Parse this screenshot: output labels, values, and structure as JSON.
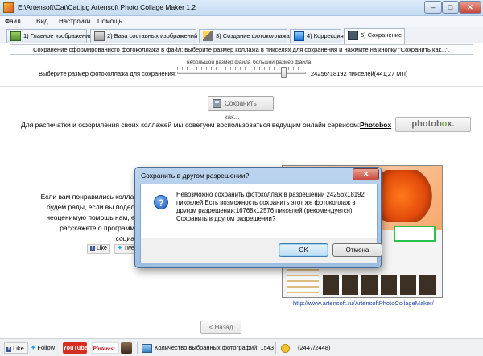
{
  "window": {
    "title": "E:\\Artensoft\\Cat\\Cat.jpg Artensoft Photo Collage Maker 1.2",
    "min": "–",
    "max": "□",
    "close": "✕"
  },
  "menu": [
    "Файл",
    "Вид",
    "Настройки",
    "Помощь"
  ],
  "tabs": [
    {
      "label": "1) Главное изображение",
      "icon": "image-edit-icon"
    },
    {
      "label": "2) База составных изображений",
      "icon": "database-images-icon"
    },
    {
      "label": "3) Создание фотоколлажа",
      "icon": "magic-wand-icon"
    },
    {
      "label": "4) Коррекция",
      "icon": "correction-icon"
    },
    {
      "label": "5) Сохранение",
      "icon": "save-disk-icon",
      "active": true
    }
  ],
  "save_panel": {
    "instruction": "Сохранение сформированного фотоколлажа в файл: выберите размер коллажа в пикселях для сохранения и нажмите на кнопку \"Сохранить как...\".",
    "size_label": "Выберите размер фотоколлажа для сохранения:",
    "small_label": "небольшой размер файла",
    "big_label": "большой размер файла",
    "size_readout": "24256*18192 пикселей(441,27 МП)",
    "slider_position": 0.84,
    "save_button": "Сохранить как..."
  },
  "print_promo": {
    "text": "Для распечатки и оформления своих коллажей мы советуем воспользоваться ведущим онлайн сервисом:",
    "link": "Photobox",
    "logo_part1": "photob",
    "logo_part2": "o",
    "logo_part3": "x."
  },
  "share": {
    "line1": "Если вам понравились коллаж",
    "line2": "будем рады, если вы подели",
    "line3": "неоценимую помощь нам, ес",
    "line4": "расскажете о программе",
    "line5": "социал",
    "fb_like": "Like",
    "tweet": "Twe"
  },
  "url": "http://www.artensoft.ru/ArtensoftPhotoCollageMaker/",
  "back_button": "< Назад",
  "statusbar": {
    "fb_like": "Like",
    "twitter_follow": "Follow",
    "youtube": "YouTube",
    "pinterest": "Pinterest",
    "count_text": "Количество выбранных фотографий: 1543",
    "ratio": "(2447/2448)"
  },
  "dialog": {
    "title": "Сохранить в другом разрешении?",
    "close": "✕",
    "message_l1": "Невозможно сохранить фотоколлаж в разрешении  24256x18192",
    "message_l2": "пикселей Есть возможность сохранить этот же фотоколлаж в",
    "message_l3": "другом разрешении:16768x12576 пикселей (рекомендуется)",
    "message_l4": "Сохранить в другом разрешении?",
    "ok": "OK",
    "cancel": "Отмена"
  }
}
